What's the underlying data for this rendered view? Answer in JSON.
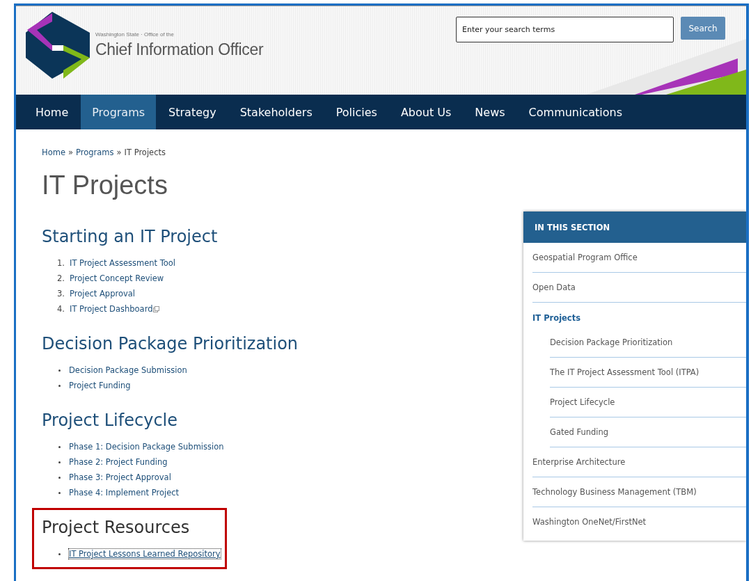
{
  "header": {
    "tagline": "Washington State · Office of the",
    "title": "Chief Information Officer",
    "search": {
      "placeholder": "Enter your search terms",
      "button": "Search"
    }
  },
  "nav": [
    {
      "label": "Home",
      "selected": false
    },
    {
      "label": "Programs",
      "selected": true
    },
    {
      "label": "Strategy",
      "selected": false
    },
    {
      "label": "Stakeholders",
      "selected": false
    },
    {
      "label": "Policies",
      "selected": false
    },
    {
      "label": "About Us",
      "selected": false
    },
    {
      "label": "News",
      "selected": false
    },
    {
      "label": "Communications",
      "selected": false
    }
  ],
  "breadcrumb": [
    {
      "label": "Home",
      "kind": "link"
    },
    {
      "label": "»",
      "kind": "separator"
    },
    {
      "label": "Programs",
      "kind": "link"
    },
    {
      "label": "»",
      "kind": "separator"
    },
    {
      "label": "IT Projects",
      "kind": "current"
    }
  ],
  "page_title": "IT Projects",
  "sections": [
    {
      "heading": "Starting an IT Project",
      "highlighted": false,
      "items": [
        {
          "kind": "numbered",
          "number": "1.",
          "label": "IT Project Assessment Tool",
          "external": false,
          "focused": false
        },
        {
          "kind": "numbered",
          "number": "2.",
          "label": "Project Concept Review",
          "external": false,
          "focused": false
        },
        {
          "kind": "numbered",
          "number": "3.",
          "label": "Project Approval",
          "external": false,
          "focused": false
        },
        {
          "kind": "numbered",
          "number": "4.",
          "label": "IT Project Dashboard",
          "external": true,
          "focused": false
        }
      ]
    },
    {
      "heading": "Decision Package Prioritization",
      "highlighted": false,
      "items": [
        {
          "kind": "bulleted",
          "label": "Decision Package Submission",
          "external": false,
          "focused": false
        },
        {
          "kind": "bulleted",
          "label": "Project Funding",
          "external": false,
          "focused": false
        }
      ]
    },
    {
      "heading": "Project Lifecycle",
      "highlighted": false,
      "items": [
        {
          "kind": "bulleted",
          "label": "Phase 1: Decision Package Submission",
          "external": false,
          "focused": false
        },
        {
          "kind": "bulleted",
          "label": "Phase 2: Project Funding",
          "external": false,
          "focused": false
        },
        {
          "kind": "bulleted",
          "label": "Phase 3: Project Approval",
          "external": false,
          "focused": false
        },
        {
          "kind": "bulleted",
          "label": "Phase 4: Implement Project",
          "external": false,
          "focused": false
        }
      ]
    },
    {
      "heading": "Project Resources",
      "highlighted": true,
      "items": [
        {
          "kind": "bulleted",
          "label": "IT Project Lessons Learned Repository",
          "external": false,
          "focused": true
        }
      ]
    }
  ],
  "sidebar": {
    "title": "IN THIS SECTION",
    "items": [
      {
        "label": "Geospatial Program Office",
        "selected": false
      },
      {
        "label": "Open Data",
        "selected": false
      },
      {
        "label": "IT Projects",
        "selected": true,
        "children": [
          {
            "label": "Decision Package Prioritization",
            "selected": false
          },
          {
            "label": "The IT Project Assessment Tool (ITPA)",
            "selected": false
          },
          {
            "label": "Project Lifecycle",
            "selected": false
          },
          {
            "label": "Gated Funding",
            "selected": false
          }
        ]
      },
      {
        "label": "Enterprise Architecture",
        "selected": false
      },
      {
        "label": "Technology Business Management (TBM)",
        "selected": false
      },
      {
        "label": "Washington OneNet/FirstNet",
        "selected": false
      }
    ]
  }
}
